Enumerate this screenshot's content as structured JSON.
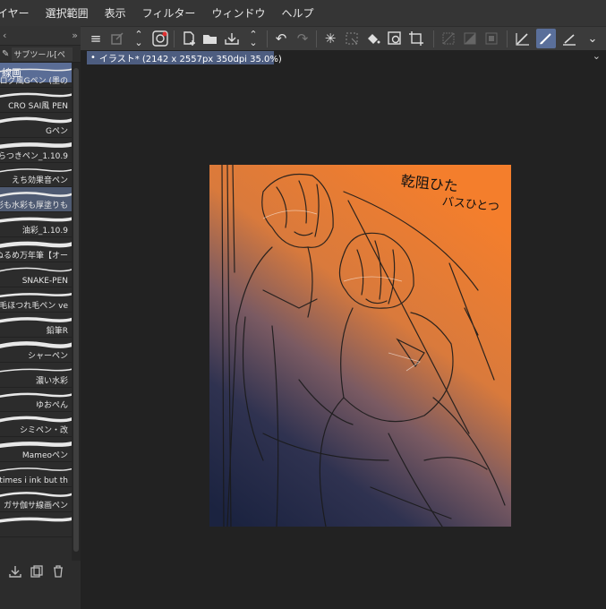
{
  "menu": [
    "イヤー",
    "選択範囲",
    "表示",
    "フィルター",
    "ウィンドウ",
    "ヘルプ"
  ],
  "left_panel": {
    "collapse_left": "‹",
    "collapse_right": "»",
    "tab_title": "サブツール[ペ",
    "group_label": "線画",
    "brushes": [
      {
        "name": "アナログ風Gペン (墨の"
      },
      {
        "name": "CRO SAI風 PEN"
      },
      {
        "name": "Gペン"
      },
      {
        "name": "ふらつきペン_1.10.9"
      },
      {
        "name": "えち効果音ペン"
      },
      {
        "name": "水彩も水彩も厚塗りも",
        "selected": true
      },
      {
        "name": "油彩_1.10.9"
      },
      {
        "name": "ぬるめ万年筆【オー"
      },
      {
        "name": "SNAKE-PEN"
      },
      {
        "name": "筆毛ほつれ毛ペン ve"
      },
      {
        "name": "鉛筆R"
      },
      {
        "name": "シャーペン"
      },
      {
        "name": "濃い水彩"
      },
      {
        "name": "ゆおぺん"
      },
      {
        "name": "シミペン・改"
      },
      {
        "name": "Mameoペン"
      },
      {
        "name": "sometimes i ink but th"
      },
      {
        "name": "ガサ伽サ線画ペン"
      },
      {
        "name": ""
      }
    ]
  },
  "toolbar_icons": [
    "menu-icon",
    "disabled-edit-icon",
    "up-down-icon",
    "cloud-sync-icon",
    "new-file-icon",
    "open-folder-icon",
    "save-icon",
    "up-down-icon",
    "undo-icon",
    "redo-icon",
    "loading-spinner-icon",
    "clear-selection-icon",
    "fill-icon",
    "transform-icon",
    "crop-icon",
    "disabled-grid-icon",
    "disabled-layer-icon",
    "disabled-frame-icon",
    "pen-tool-icon",
    "brush-tool-icon",
    "eraser-tool-icon",
    "chevron-down-icon"
  ],
  "document_tab": {
    "title": "イラスト* (2142 x 2557px 350dpi 35.0%)"
  },
  "artwork": {
    "handwritten_text": [
      "乾阻ひた",
      "バスひとつ"
    ],
    "colors": {
      "top": "#f47e2c",
      "middle": "#b57050",
      "bottom": "#1d2440",
      "accent": "#5a6d96"
    }
  }
}
